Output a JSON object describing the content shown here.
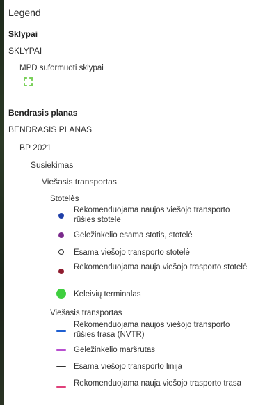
{
  "legend": {
    "title": "Legend",
    "sklypai": {
      "section_title": "Sklypai",
      "layer_name": "SKLYPAI",
      "item_label": "MPD suformuoti sklypai"
    },
    "bendrasis": {
      "section_title": "Bendrasis planas",
      "layer_name": "BENDRASIS PLANAS",
      "sublayer": "BP 2021",
      "group": "Susiekimas",
      "subgroup": "Viešasis transportas",
      "stoteles": {
        "heading": "Stotelės",
        "items": [
          {
            "label": "Rekomenduojama naujos viešojo transporto rūšies stotelė",
            "color": "#1f3fa8",
            "icon": "blue-dot-icon"
          },
          {
            "label": "Geležinkelio esama stotis, stotelė",
            "color": "#7a2a8c",
            "icon": "purple-dot-icon"
          },
          {
            "label": "Esama viešojo transporto stotelė",
            "color": "#333333",
            "icon": "hollow-circle-icon"
          },
          {
            "label": "Rekomenduojama nauja viešojo trasporto stotelė",
            "color": "#8e1b2e",
            "icon": "darkred-dot-icon"
          },
          {
            "label": "Keleivių terminalas",
            "color": "#3fcf3f",
            "icon": "green-circle-icon"
          }
        ]
      },
      "transportas": {
        "heading": "Viešasis transportas",
        "items": [
          {
            "label": "Rekomenduojama naujos viešojo transporto rūšies trasa (NVTR)",
            "color": "#1f5fd1",
            "icon": "blue-line-icon"
          },
          {
            "label": "Geležinkelio maršrutas",
            "color": "#b84fd0",
            "icon": "purple-line-icon"
          },
          {
            "label": "Esama viešojo transporto linija",
            "color": "#333333",
            "icon": "black-line-icon"
          },
          {
            "label": "Rekomenduojama nauja viešojo trasporto trasa",
            "color": "#e0407a",
            "icon": "pink-line-icon"
          }
        ]
      }
    }
  }
}
